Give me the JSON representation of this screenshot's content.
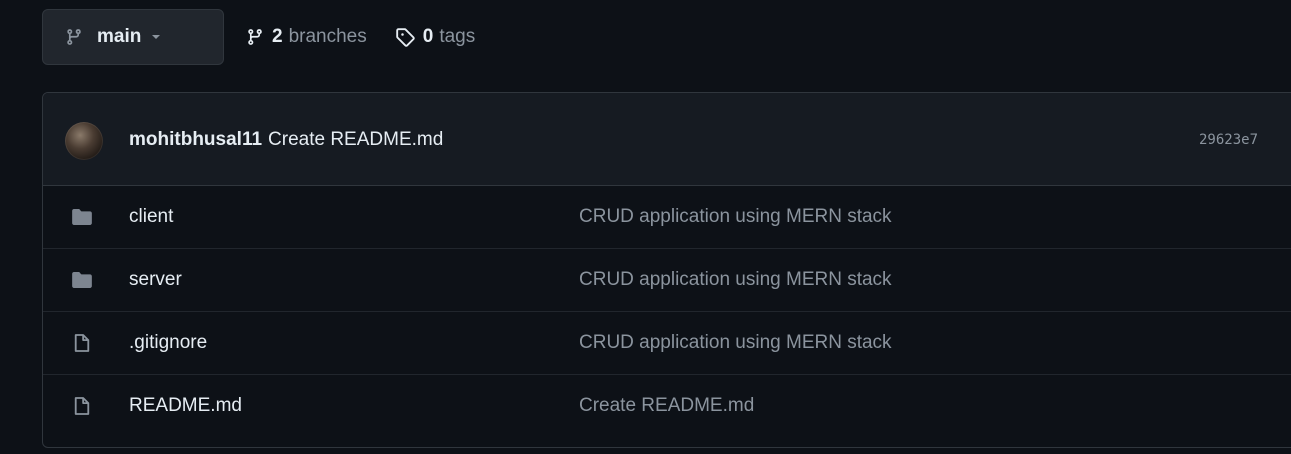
{
  "toolbar": {
    "branch": "main",
    "branches_count": "2",
    "branches_label": "branches",
    "tags_count": "0",
    "tags_label": "tags"
  },
  "commit": {
    "author": "mohitbhusal11",
    "message": "Create README.md",
    "sha": "29623e7"
  },
  "files": [
    {
      "type": "folder",
      "icon": "folder-icon",
      "name": "client",
      "commit": "CRUD application using MERN stack"
    },
    {
      "type": "folder",
      "icon": "folder-icon",
      "name": "server",
      "commit": "CRUD application using MERN stack"
    },
    {
      "type": "file",
      "icon": "file-icon",
      "name": ".gitignore",
      "commit": "CRUD application using MERN stack"
    },
    {
      "type": "file",
      "icon": "file-icon",
      "name": "README.md",
      "commit": "Create README.md"
    }
  ],
  "colors": {
    "background": "#0d1117",
    "header_bg": "#161b22",
    "border": "#30363d",
    "text": "#e6edf3",
    "muted": "#8b949e",
    "folder": "#7d8590"
  }
}
